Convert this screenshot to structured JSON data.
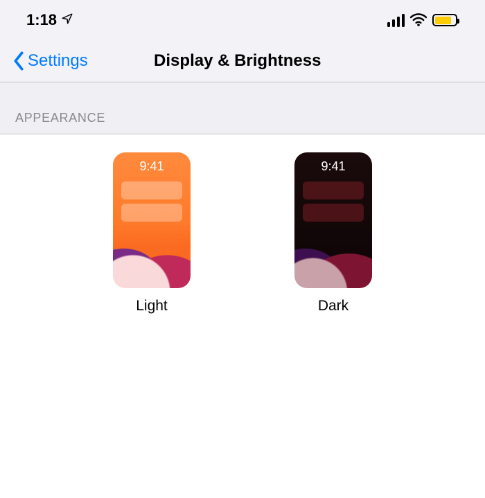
{
  "status_bar": {
    "time": "1:18",
    "battery_color": "#ffcc00"
  },
  "nav": {
    "back_label": "Settings",
    "title": "Display & Brightness",
    "accent_color": "#007aff"
  },
  "section": {
    "header": "APPEARANCE"
  },
  "appearance": {
    "preview_time": "9:41",
    "options": [
      {
        "label": "Light",
        "mode": "light"
      },
      {
        "label": "Dark",
        "mode": "dark"
      }
    ]
  }
}
